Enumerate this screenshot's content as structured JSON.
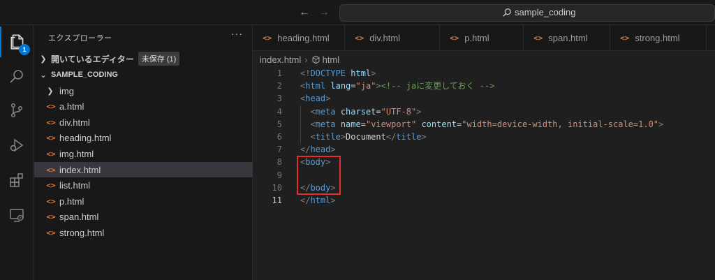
{
  "titlebar": {
    "search_text": "sample_coding"
  },
  "activity_bar": {
    "explorer_badge": "1"
  },
  "sidebar": {
    "title": "エクスプローラー",
    "more": "···",
    "open_editors_label": "開いているエディター",
    "unsaved_badge": "未保存 (1)",
    "folder_name": "SAMPLE_CODING",
    "items": [
      {
        "type": "folder",
        "label": "img"
      },
      {
        "type": "file",
        "label": "a.html"
      },
      {
        "type": "file",
        "label": "div.html"
      },
      {
        "type": "file",
        "label": "heading.html"
      },
      {
        "type": "file",
        "label": "img.html"
      },
      {
        "type": "file",
        "label": "index.html",
        "selected": true
      },
      {
        "type": "file",
        "label": "list.html"
      },
      {
        "type": "file",
        "label": "p.html"
      },
      {
        "type": "file",
        "label": "span.html"
      },
      {
        "type": "file",
        "label": "strong.html"
      }
    ]
  },
  "tabs": [
    {
      "label": "heading.html"
    },
    {
      "label": "div.html"
    },
    {
      "label": "p.html"
    },
    {
      "label": "span.html"
    },
    {
      "label": "strong.html"
    }
  ],
  "breadcrumb": {
    "file": "index.html",
    "symbol": "html"
  },
  "editor": {
    "current_line": 11,
    "lines": [
      [
        [
          "<!",
          "punc"
        ],
        [
          "DOCTYPE",
          "tag"
        ],
        [
          " html",
          "attr"
        ],
        [
          ">",
          "punc"
        ]
      ],
      [
        [
          "<",
          "punc"
        ],
        [
          "html",
          "tag"
        ],
        [
          " ",
          "text"
        ],
        [
          "lang",
          "attr"
        ],
        [
          "=",
          "text"
        ],
        [
          "\"ja\"",
          "str"
        ],
        [
          ">",
          "punc"
        ],
        [
          "<!-- jaに変更しておく -->",
          "com"
        ]
      ],
      [
        [
          "<",
          "punc"
        ],
        [
          "head",
          "tag"
        ],
        [
          ">",
          "punc"
        ]
      ],
      [
        [
          "  ",
          "text"
        ],
        [
          "<",
          "punc"
        ],
        [
          "meta",
          "tag"
        ],
        [
          " ",
          "text"
        ],
        [
          "charset",
          "attr"
        ],
        [
          "=",
          "text"
        ],
        [
          "\"UTF-8\"",
          "str"
        ],
        [
          ">",
          "punc"
        ]
      ],
      [
        [
          "  ",
          "text"
        ],
        [
          "<",
          "punc"
        ],
        [
          "meta",
          "tag"
        ],
        [
          " ",
          "text"
        ],
        [
          "name",
          "attr"
        ],
        [
          "=",
          "text"
        ],
        [
          "\"viewport\"",
          "str"
        ],
        [
          " ",
          "text"
        ],
        [
          "content",
          "attr"
        ],
        [
          "=",
          "text"
        ],
        [
          "\"width=device-width, initial-scale=1.0\"",
          "str"
        ],
        [
          ">",
          "punc"
        ]
      ],
      [
        [
          "  ",
          "text"
        ],
        [
          "<",
          "punc"
        ],
        [
          "title",
          "tag"
        ],
        [
          ">",
          "punc"
        ],
        [
          "Document",
          "text"
        ],
        [
          "</",
          "punc"
        ],
        [
          "title",
          "tag"
        ],
        [
          ">",
          "punc"
        ]
      ],
      [
        [
          "</",
          "punc"
        ],
        [
          "head",
          "tag"
        ],
        [
          ">",
          "punc"
        ]
      ],
      [
        [
          "<",
          "punc"
        ],
        [
          "body",
          "tag"
        ],
        [
          ">",
          "punc"
        ]
      ],
      [],
      [
        [
          "</",
          "punc"
        ],
        [
          "body",
          "tag"
        ],
        [
          ">",
          "punc"
        ]
      ],
      [
        [
          "</",
          "punc"
        ],
        [
          "html",
          "tag"
        ],
        [
          ">",
          "punc"
        ]
      ]
    ]
  },
  "colors": {
    "accent": "#0078d4",
    "highlight": "#e52e2e",
    "html_icon": "#e37933"
  }
}
